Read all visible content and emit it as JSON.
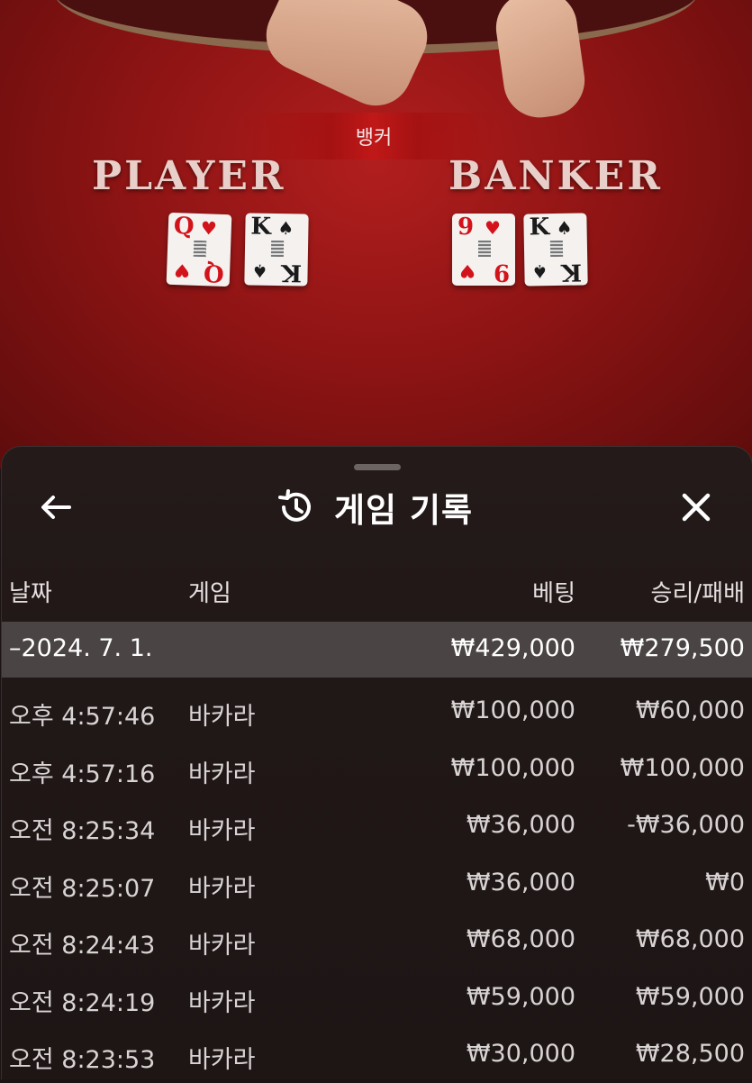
{
  "table": {
    "result_banner": "뱅커",
    "player_label": "PLAYER",
    "banker_label": "BANKER",
    "player_cards": [
      {
        "rank": "Q",
        "suit": "♥",
        "color": "#d3131b"
      },
      {
        "rank": "K",
        "suit": "♠",
        "color": "#1a1a1a"
      }
    ],
    "banker_cards": [
      {
        "rank": "9",
        "suit": "♥",
        "color": "#d3131b"
      },
      {
        "rank": "K",
        "suit": "♠",
        "color": "#1a1a1a"
      }
    ]
  },
  "history": {
    "title": "게임 기록",
    "icons": {
      "back": "arrow-left-icon",
      "title": "history-icon",
      "close": "close-icon"
    },
    "columns": {
      "date": "날짜",
      "game": "게임",
      "bet": "베팅",
      "result": "승리/패배"
    },
    "summary": {
      "date": "–2024. 7. 1.",
      "bet": "₩429,000",
      "result": "₩279,500"
    },
    "rows": [
      {
        "time": "오후 4:57:46",
        "game": "바카라",
        "bet": "₩100,000",
        "result": "₩60,000"
      },
      {
        "time": "오후 4:57:16",
        "game": "바카라",
        "bet": "₩100,000",
        "result": "₩100,000"
      },
      {
        "time": "오전 8:25:34",
        "game": "바카라",
        "bet": "₩36,000",
        "result": "-₩36,000"
      },
      {
        "time": "오전 8:25:07",
        "game": "바카라",
        "bet": "₩36,000",
        "result": "₩0"
      },
      {
        "time": "오전 8:24:43",
        "game": "바카라",
        "bet": "₩68,000",
        "result": "₩68,000"
      },
      {
        "time": "오전 8:24:19",
        "game": "바카라",
        "bet": "₩59,000",
        "result": "₩59,000"
      },
      {
        "time": "오전 8:23:53",
        "game": "바카라",
        "bet": "₩30,000",
        "result": "₩28,500"
      }
    ]
  },
  "colors": {
    "table_felt": "#9c1616",
    "sheet_bg": "#221818",
    "summary_row_bg": "#4a4444"
  }
}
